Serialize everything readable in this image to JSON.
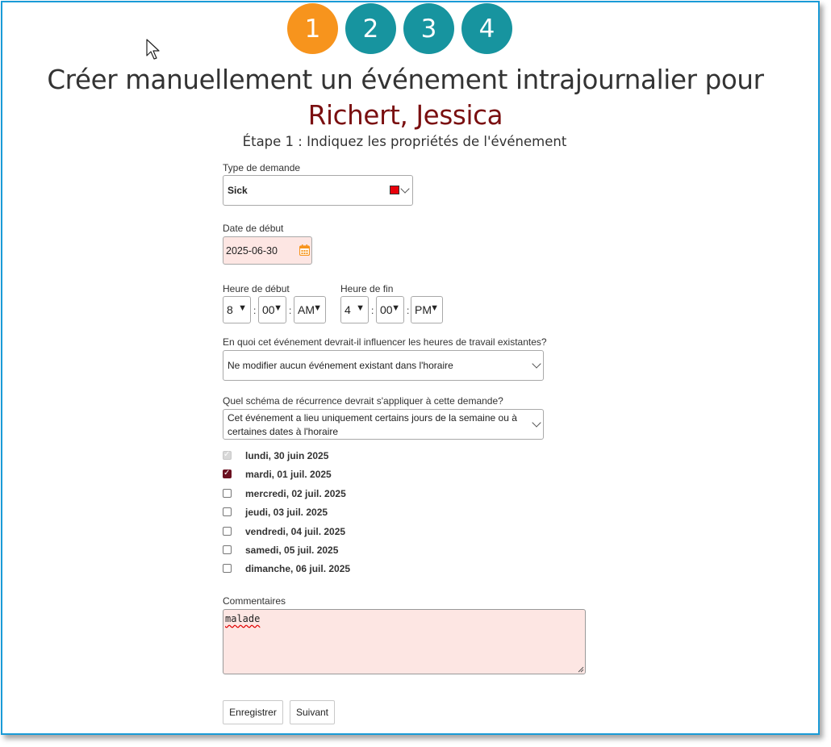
{
  "steps": [
    "1",
    "2",
    "3",
    "4"
  ],
  "title": {
    "prefix": "Créer manuellement un événement intrajournalier pour ",
    "name": "Richert, Jessica"
  },
  "subtitle": "Étape 1 : Indiquez les propriétés de l'événement",
  "request_type": {
    "label": "Type de demande",
    "value": "Sick",
    "color": "#e8000b"
  },
  "start_date": {
    "label": "Date de début",
    "value": "2025-06-30"
  },
  "start_time": {
    "label": "Heure de début",
    "hour": "8",
    "minute": "00",
    "ampm": "AM"
  },
  "end_time": {
    "label": "Heure de fin",
    "hour": "4",
    "minute": "00",
    "ampm": "PM"
  },
  "influence": {
    "label": "En quoi cet événement devrait-il influencer les heures de travail existantes?",
    "value": "Ne modifier aucun événement existant dans l'horaire"
  },
  "recurrence": {
    "label": "Quel schéma de récurrence devrait s'appliquer à cette demande?",
    "value_line1": "Cet événement a lieu uniquement certains jours de la semaine ou à",
    "value_line2": "certaines dates à l'horaire"
  },
  "days": [
    {
      "label": "lundi, 30 juin 2025",
      "checked": true,
      "disabled": true
    },
    {
      "label": "mardi, 01 juil. 2025",
      "checked": true,
      "disabled": false
    },
    {
      "label": "mercredi, 02 juil. 2025",
      "checked": false,
      "disabled": false
    },
    {
      "label": "jeudi, 03 juil. 2025",
      "checked": false,
      "disabled": false
    },
    {
      "label": "vendredi, 04 juil. 2025",
      "checked": false,
      "disabled": false
    },
    {
      "label": "samedi, 05 juil. 2025",
      "checked": false,
      "disabled": false
    },
    {
      "label": "dimanche, 06 juil. 2025",
      "checked": false,
      "disabled": false
    }
  ],
  "comments": {
    "label": "Commentaires",
    "value": "malade"
  },
  "buttons": {
    "save": "Enregistrer",
    "next": "Suivant"
  },
  "colors": {
    "active_step": "#f7941d",
    "step": "#17949f",
    "name": "#7a0f10",
    "required_bg": "#fde6e3",
    "frame": "#1a9bd7"
  }
}
